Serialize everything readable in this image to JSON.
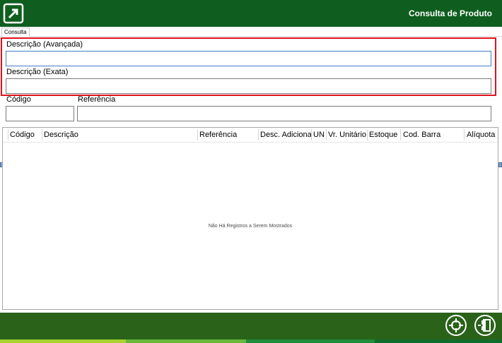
{
  "header": {
    "title": "Consulta de Produto"
  },
  "tabs": [
    {
      "label": "Consulta"
    }
  ],
  "fields": {
    "descricao_avancada": {
      "label": "Descrição (Avançada)",
      "value": ""
    },
    "descricao_exata": {
      "label": "Descrição (Exata)",
      "value": ""
    },
    "codigo": {
      "label": "Código",
      "value": ""
    },
    "referencia": {
      "label": "Referência",
      "value": ""
    }
  },
  "grid": {
    "columns": [
      "Código",
      "Descrição",
      "Referência",
      "Desc. Adicional",
      "UN",
      "Vr. Unitário",
      "Estoque",
      "Cod. Barra",
      "Alíquota"
    ],
    "empty_message": "Não Há Registros a Serem Mostrados"
  },
  "footer": {
    "buttons": [
      {
        "icon": "crosshair-icon"
      },
      {
        "icon": "exit-door-icon"
      }
    ]
  },
  "colors": {
    "header_bg": "#0f5e1f",
    "footer_bg": "#2a621a",
    "highlight": "#e0131d",
    "bottom_bar": [
      "#a6d32d",
      "#6ab83a",
      "#1f8c3a",
      "#0f6e2c"
    ]
  }
}
